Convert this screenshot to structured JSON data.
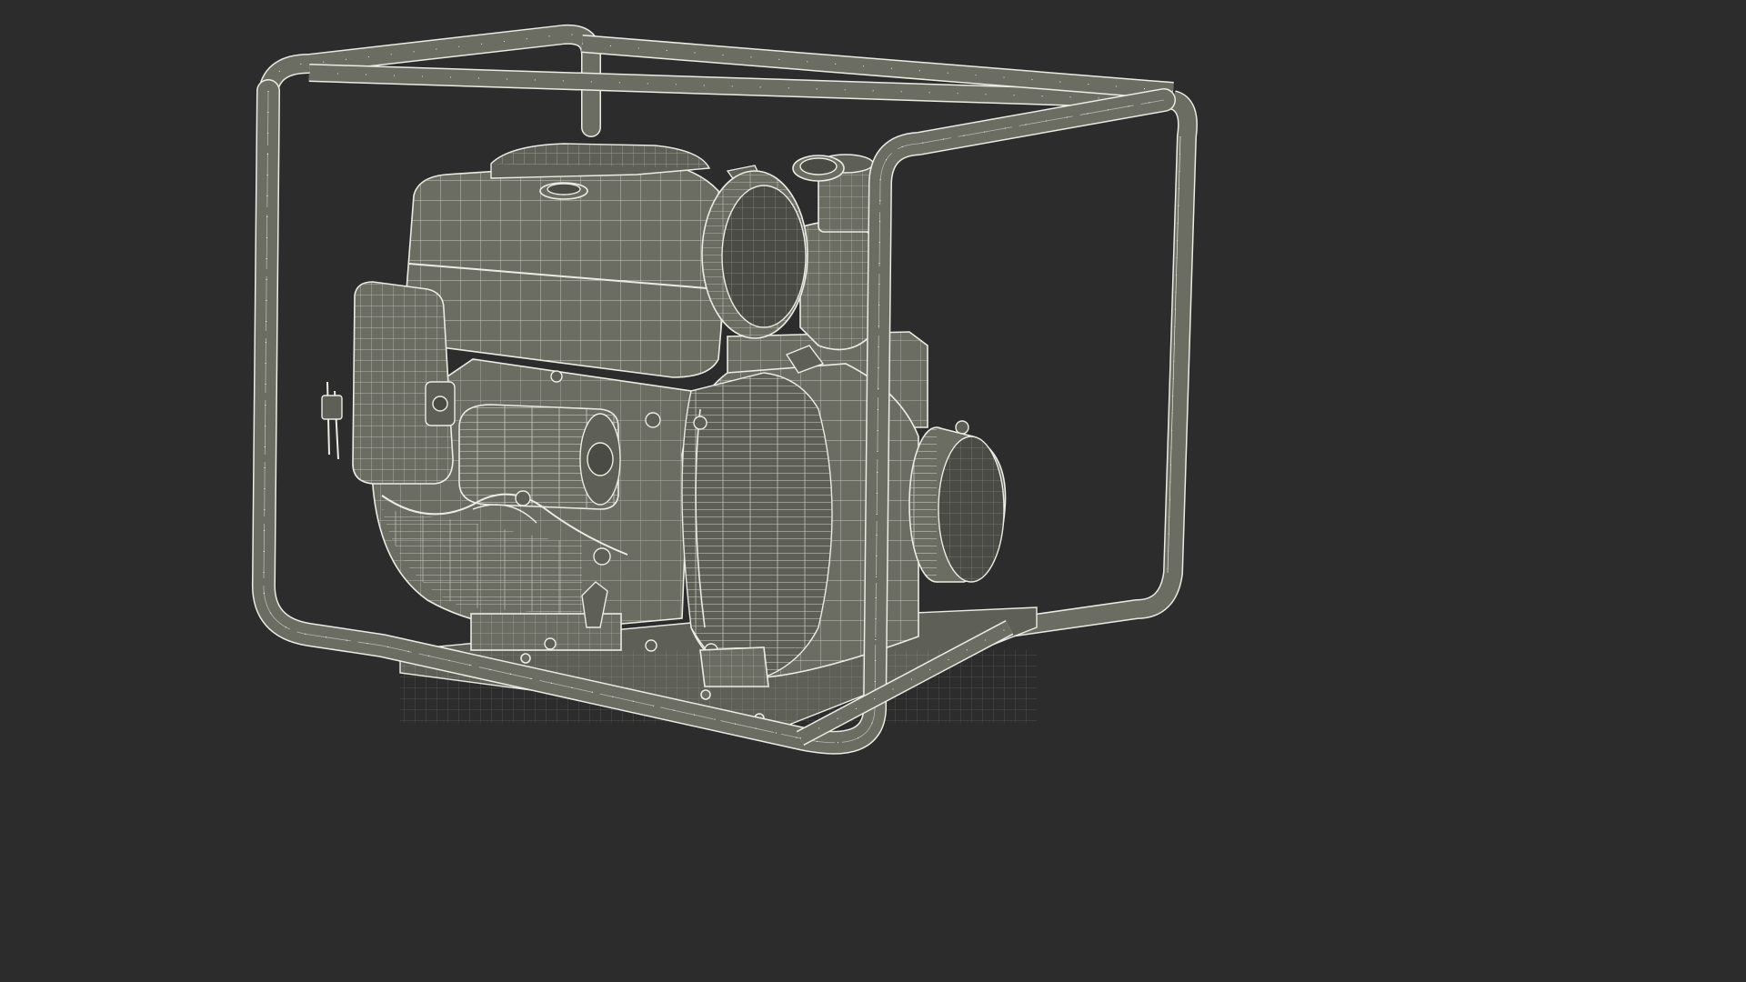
{
  "scene": {
    "background": "#2c2c2c",
    "subject": "water-pump",
    "render_style": "wireframe",
    "mesh_color": "#6b6d63",
    "wire_color": "#e4e4dc"
  }
}
